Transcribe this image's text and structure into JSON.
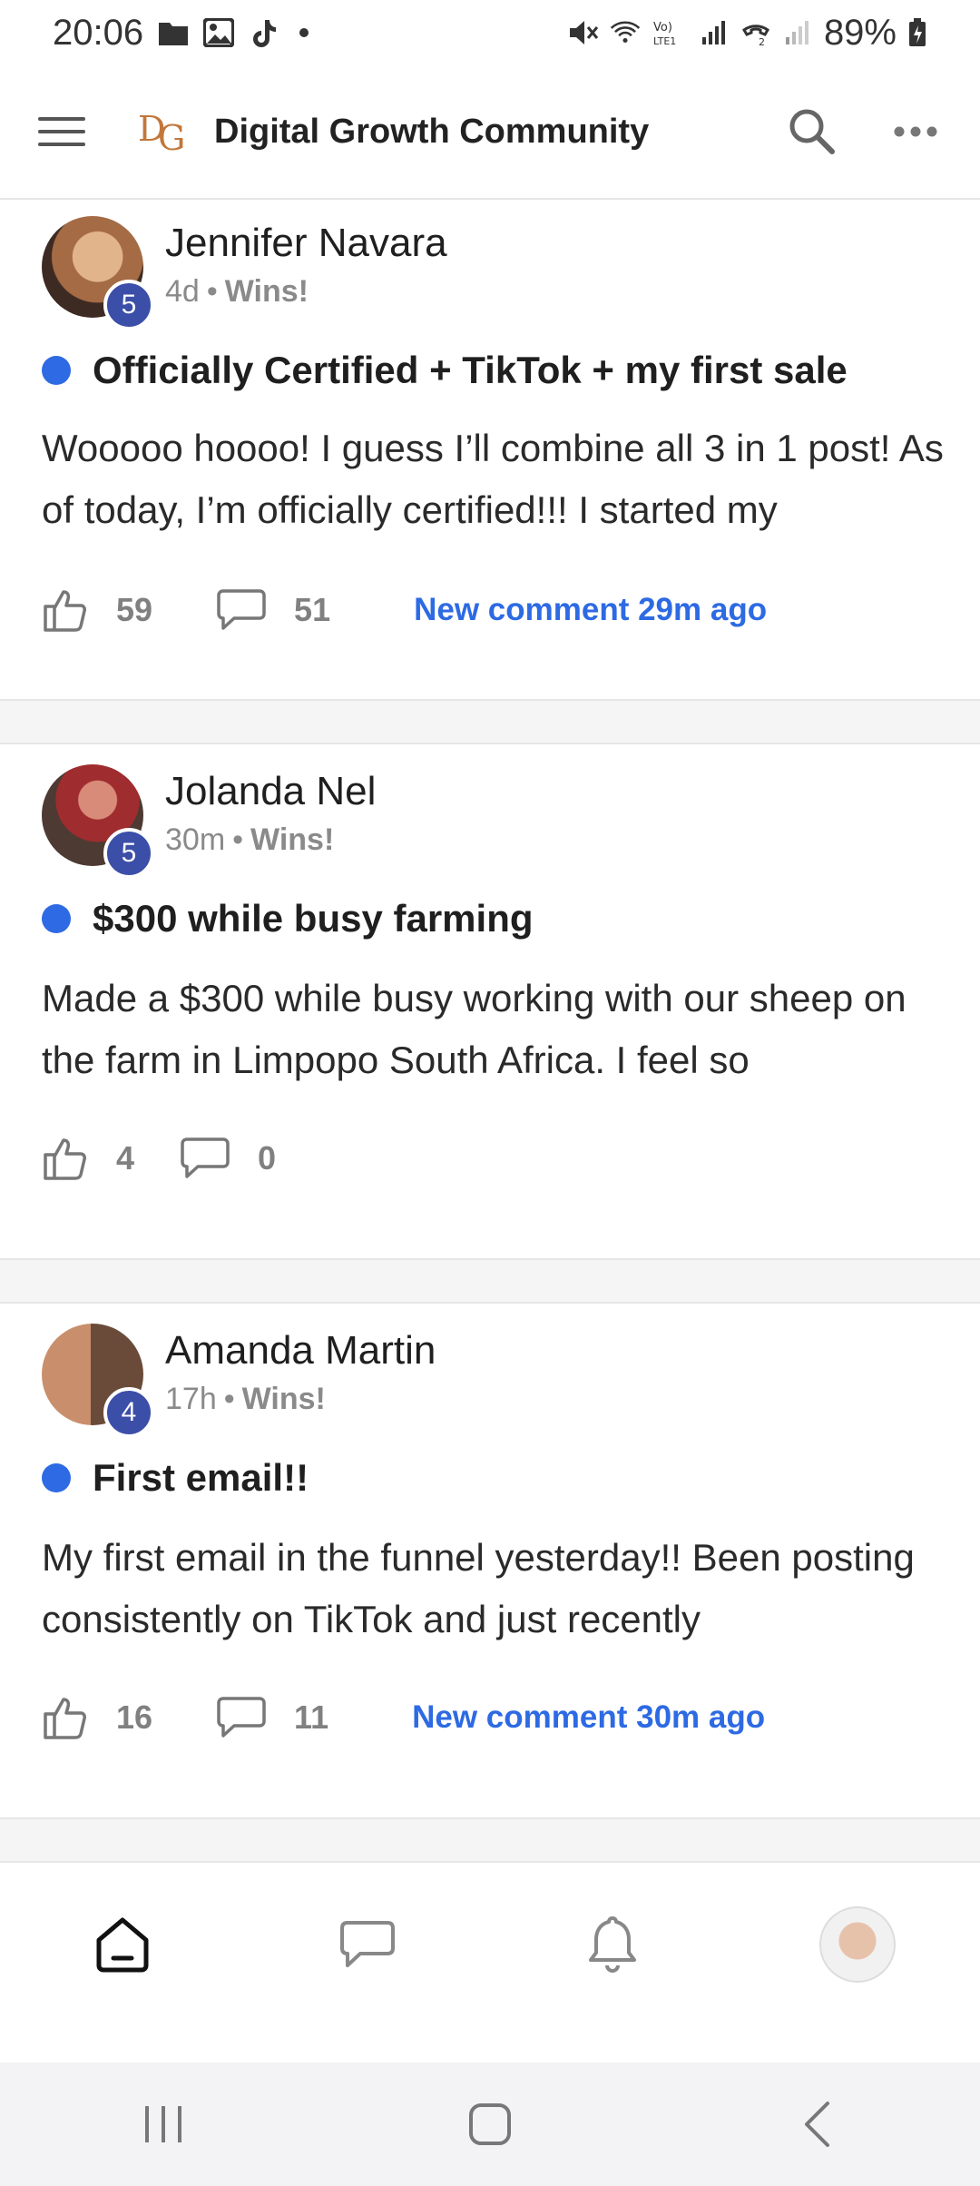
{
  "status_bar": {
    "time": "20:06",
    "left_icons": [
      "folder-icon",
      "image-icon",
      "tiktok-icon",
      "dot-icon"
    ],
    "right_icons": [
      "mute-icon",
      "wifi-icon",
      "volte-icon",
      "signal-icon",
      "call-icon",
      "signal-weak-icon"
    ],
    "battery": "89%"
  },
  "header": {
    "logo_text": "DG",
    "title": "Digital Growth Community",
    "accent_color": "#c2773a"
  },
  "posts": [
    {
      "author": "Jennifer Navara",
      "level": "5",
      "time": "4d",
      "separator": "•",
      "category": "Wins!",
      "title": "Officially Certified + TikTok + my first sale",
      "body": "Wooooo hoooo! I guess I’ll combine all 3 in 1 post! As of today, I’m officially certified!!! I started my",
      "likes": "59",
      "comments": "51",
      "new_comment": "New comment 29m ago"
    },
    {
      "author": "Jolanda Nel",
      "level": "5",
      "time": "30m",
      "separator": "•",
      "category": "Wins!",
      "title": "$300 while busy farming",
      "body": "Made a $300 while busy working with our sheep on the farm in Limpopo South Africa. I feel so",
      "likes": "4",
      "comments": "0",
      "new_comment": ""
    },
    {
      "author": "Amanda Martin",
      "level": "4",
      "time": "17h",
      "separator": "•",
      "category": "Wins!",
      "title": "First email!!",
      "body": "My first email in the funnel yesterday!! Been posting consistently on TikTok and just recently",
      "likes": "16",
      "comments": "11",
      "new_comment": "New comment 30m ago"
    }
  ],
  "bottom_nav": {
    "items": [
      "home-icon",
      "chat-icon",
      "bell-icon",
      "profile-avatar"
    ]
  },
  "colors": {
    "unread": "#2d6ae3",
    "link": "#2d6ae3",
    "badge": "#3b4ea8"
  }
}
